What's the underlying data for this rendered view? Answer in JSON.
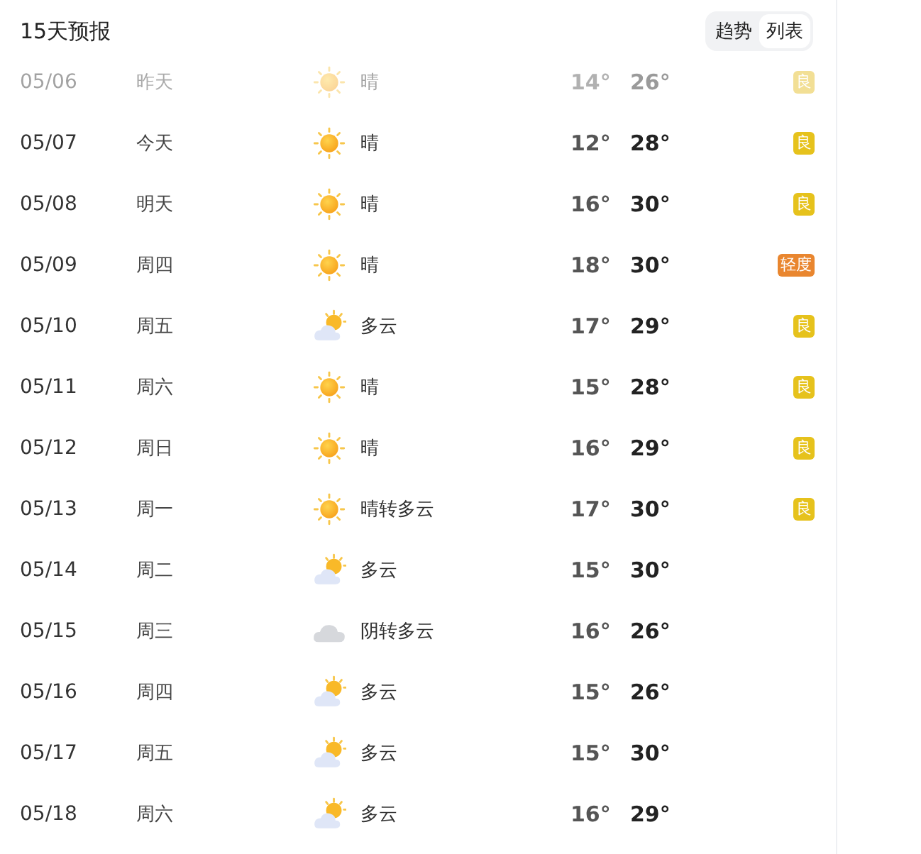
{
  "title": "15天预报",
  "view_toggle": [
    {
      "label": "趋势",
      "selected": false
    },
    {
      "label": "列表",
      "selected": true
    }
  ],
  "days": [
    {
      "date": "05/06",
      "day": "昨天",
      "kind": "sunny",
      "weather": "晴",
      "low": "14°",
      "high": "26°",
      "past": true,
      "aqi": {
        "label": "良",
        "color": "#f2df95"
      }
    },
    {
      "date": "05/07",
      "day": "今天",
      "kind": "sunny",
      "weather": "晴",
      "low": "12°",
      "high": "28°",
      "past": false,
      "aqi": {
        "label": "良",
        "color": "#e6c21c"
      }
    },
    {
      "date": "05/08",
      "day": "明天",
      "kind": "sunny",
      "weather": "晴",
      "low": "16°",
      "high": "30°",
      "past": false,
      "aqi": {
        "label": "良",
        "color": "#e6c21c"
      }
    },
    {
      "date": "05/09",
      "day": "周四",
      "kind": "sunny",
      "weather": "晴",
      "low": "18°",
      "high": "30°",
      "past": false,
      "aqi": {
        "label": "轻度",
        "color": "#e9862f"
      }
    },
    {
      "date": "05/10",
      "day": "周五",
      "kind": "partly",
      "weather": "多云",
      "low": "17°",
      "high": "29°",
      "past": false,
      "aqi": {
        "label": "良",
        "color": "#e6c21c"
      }
    },
    {
      "date": "05/11",
      "day": "周六",
      "kind": "sunny",
      "weather": "晴",
      "low": "15°",
      "high": "28°",
      "past": false,
      "aqi": {
        "label": "良",
        "color": "#e6c21c"
      }
    },
    {
      "date": "05/12",
      "day": "周日",
      "kind": "sunny",
      "weather": "晴",
      "low": "16°",
      "high": "29°",
      "past": false,
      "aqi": {
        "label": "良",
        "color": "#e6c21c"
      }
    },
    {
      "date": "05/13",
      "day": "周一",
      "kind": "sunny",
      "weather": "晴转多云",
      "low": "17°",
      "high": "30°",
      "past": false,
      "aqi": {
        "label": "良",
        "color": "#e6c21c"
      }
    },
    {
      "date": "05/14",
      "day": "周二",
      "kind": "partly",
      "weather": "多云",
      "low": "15°",
      "high": "30°",
      "past": false
    },
    {
      "date": "05/15",
      "day": "周三",
      "kind": "overcast",
      "weather": "阴转多云",
      "low": "16°",
      "high": "26°",
      "past": false
    },
    {
      "date": "05/16",
      "day": "周四",
      "kind": "partly",
      "weather": "多云",
      "low": "15°",
      "high": "26°",
      "past": false
    },
    {
      "date": "05/17",
      "day": "周五",
      "kind": "partly",
      "weather": "多云",
      "low": "15°",
      "high": "30°",
      "past": false
    },
    {
      "date": "05/18",
      "day": "周六",
      "kind": "partly",
      "weather": "多云",
      "low": "16°",
      "high": "29°",
      "past": false
    }
  ]
}
